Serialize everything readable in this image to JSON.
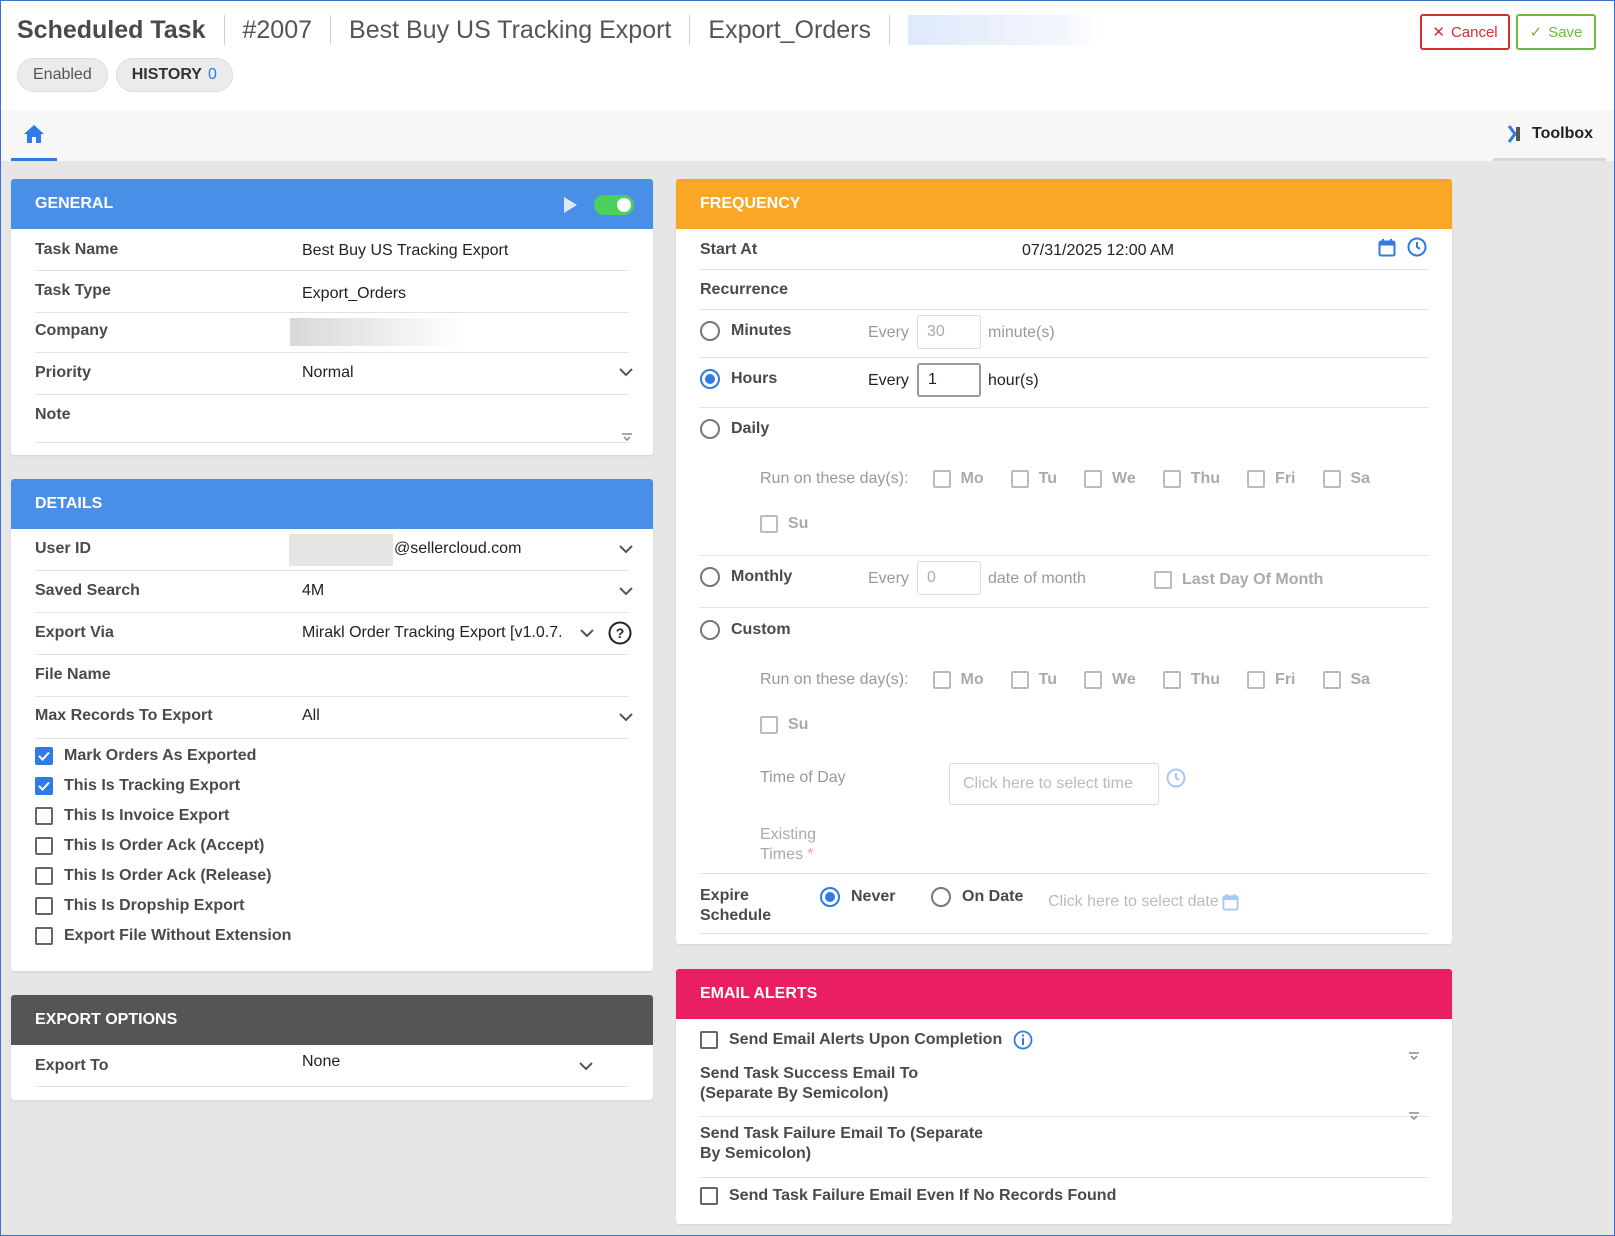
{
  "header": {
    "title": "Scheduled Task",
    "task_no": "#2007",
    "task_name": "Best Buy US Tracking Export",
    "task_type": "Export_Orders",
    "status_pill": "Enabled",
    "history_label": "HISTORY",
    "history_count": "0",
    "cancel_label": "Cancel",
    "save_label": "Save"
  },
  "tabs": {
    "toolbox_label": "Toolbox"
  },
  "general": {
    "heading": "GENERAL",
    "enabled": true,
    "fields": {
      "task_name_label": "Task Name",
      "task_name": "Best Buy US Tracking Export",
      "task_type_label": "Task Type",
      "task_type": "Export_Orders",
      "company_label": "Company",
      "priority_label": "Priority",
      "priority": "Normal",
      "note_label": "Note"
    }
  },
  "details": {
    "heading": "DETAILS",
    "user_id_label": "User ID",
    "user_id_suffix": "@sellercloud.com",
    "saved_search_label": "Saved Search",
    "saved_search": "4M",
    "export_via_label": "Export Via",
    "export_via": "Mirakl Order Tracking Export [v1.0.7.",
    "file_name_label": "File Name",
    "max_records_label": "Max Records To Export",
    "max_records": "All",
    "checkboxes": [
      {
        "label": "Mark Orders As Exported",
        "checked": true
      },
      {
        "label": "This Is Tracking Export",
        "checked": true
      },
      {
        "label": "This Is Invoice Export",
        "checked": false
      },
      {
        "label": "This Is Order Ack (Accept)",
        "checked": false
      },
      {
        "label": "This Is Order Ack (Release)",
        "checked": false
      },
      {
        "label": "This Is Dropship Export",
        "checked": false
      },
      {
        "label": "Export File Without Extension",
        "checked": false
      }
    ]
  },
  "export_options": {
    "heading": "EXPORT OPTIONS",
    "export_to_label": "Export To",
    "export_to": "None"
  },
  "frequency": {
    "heading": "FREQUENCY",
    "start_at_label": "Start At",
    "start_at": "07/31/2025 12:00 AM",
    "recurrence_label": "Recurrence",
    "minutes_label": "Minutes",
    "every": "Every",
    "minutes_value": "30",
    "minutes_unit": "minute(s)",
    "hours_label": "Hours",
    "hours_value": "1",
    "hours_unit": "hour(s)",
    "daily_label": "Daily",
    "run_days_label": "Run on these day(s):",
    "days": [
      "Mo",
      "Tu",
      "We",
      "Thu",
      "Fri",
      "Sa",
      "Su"
    ],
    "monthly_label": "Monthly",
    "monthly_value": "0",
    "monthly_unit": "date of month",
    "last_day_label": "Last Day Of Month",
    "custom_label": "Custom",
    "time_of_day_label": "Time of Day",
    "time_placeholder": "Click here to select time",
    "existing_label_1": "Existing",
    "existing_label_2": "Times",
    "required_mark": "*",
    "expire_label_1": "Expire",
    "expire_label_2": "Schedule",
    "never_label": "Never",
    "on_date_label": "On Date",
    "date_placeholder": "Click here to select date"
  },
  "email_alerts": {
    "heading": "EMAIL ALERTS",
    "send_alerts_label": "Send Email Alerts Upon Completion",
    "success_label_1": "Send Task Success Email To",
    "success_label_2": "(Separate By Semicolon)",
    "failure_label_1": "Send Task Failure Email To (Separate",
    "failure_label_2": "By Semicolon)",
    "failure_no_records_label": "Send Task Failure Email Even If No Records Found"
  },
  "colors": {
    "primary": "#4a8fe7",
    "frequency": "#faa627",
    "alerts": "#e91e63",
    "export": "#555555",
    "cancel": "#d22f2f",
    "save": "#6fb742"
  }
}
